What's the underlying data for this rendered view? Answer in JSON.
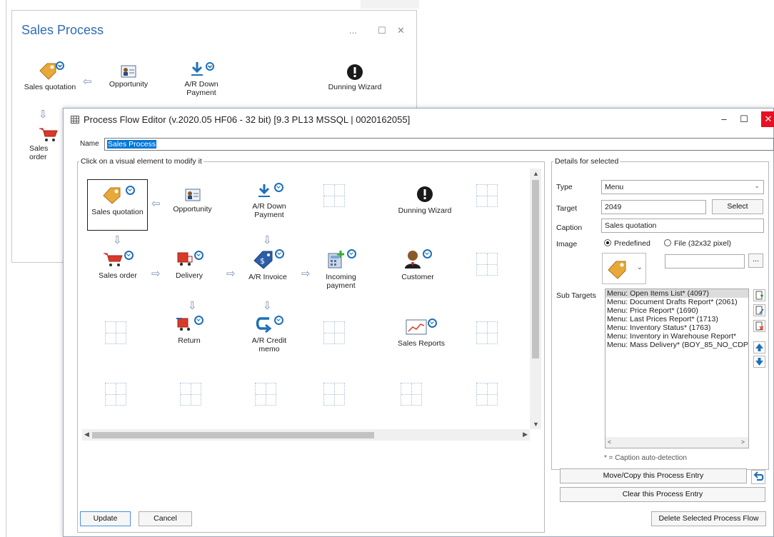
{
  "background_window": {
    "title": "Sales Process",
    "controls": [
      "...",
      "☐",
      "✕"
    ],
    "nodes": [
      {
        "label": "Sales quotation"
      },
      {
        "label": "Opportunity"
      },
      {
        "label": "A/R Down Payment"
      },
      {
        "label": "Dunning Wizard"
      },
      {
        "label": "Sales order"
      }
    ]
  },
  "editor": {
    "title": "Process Flow Editor (v.2020.05 HF06 - 32 bit) [9.3 PL13 MSSQL | 0020162055]",
    "name_label": "Name",
    "name_value": "Sales Process",
    "visual_group_legend": "Click on a visual element to modify it",
    "flow": {
      "sales_quotation": "Sales quotation",
      "opportunity": "Opportunity",
      "ar_down_payment": "A/R Down Payment",
      "dunning_wizard": "Dunning Wizard",
      "sales_order": "Sales order",
      "delivery": "Delivery",
      "ar_invoice": "A/R Invoice",
      "incoming_payment": "Incoming payment",
      "customer": "Customer",
      "return": "Return",
      "ar_credit_memo": "A/R Credit memo",
      "sales_reports": "Sales Reports"
    },
    "details": {
      "legend": "Details for selected",
      "type_label": "Type",
      "type_value": "Menu",
      "target_label": "Target",
      "target_value": "2049",
      "select_button": "Select",
      "caption_label": "Caption",
      "caption_value": "Sales quotation",
      "image_label": "Image",
      "image_predefined": "Predefined",
      "image_file": "File (32x32 pixel)",
      "browse_button": "...",
      "subtargets_label": "Sub Targets",
      "subtargets": [
        "Menu: Open Items List* (4097)",
        "Menu: Document Drafts Report* (2061)",
        "Menu: Price Report* (1690)",
        "Menu: Last Prices Report* (1713)",
        "Menu: Inventory Status* (1763)",
        "Menu: Inventory in Warehouse Report*",
        "Menu: Mass Delivery* (BOY_85_NO_CDP"
      ],
      "caption_hint": "* = Caption auto-detection",
      "move_copy_button": "Move/Copy this Process Entry",
      "clear_button": "Clear this Process Entry"
    },
    "update_button": "Update",
    "cancel_button": "Cancel",
    "delete_button": "Delete Selected Process Flow"
  }
}
